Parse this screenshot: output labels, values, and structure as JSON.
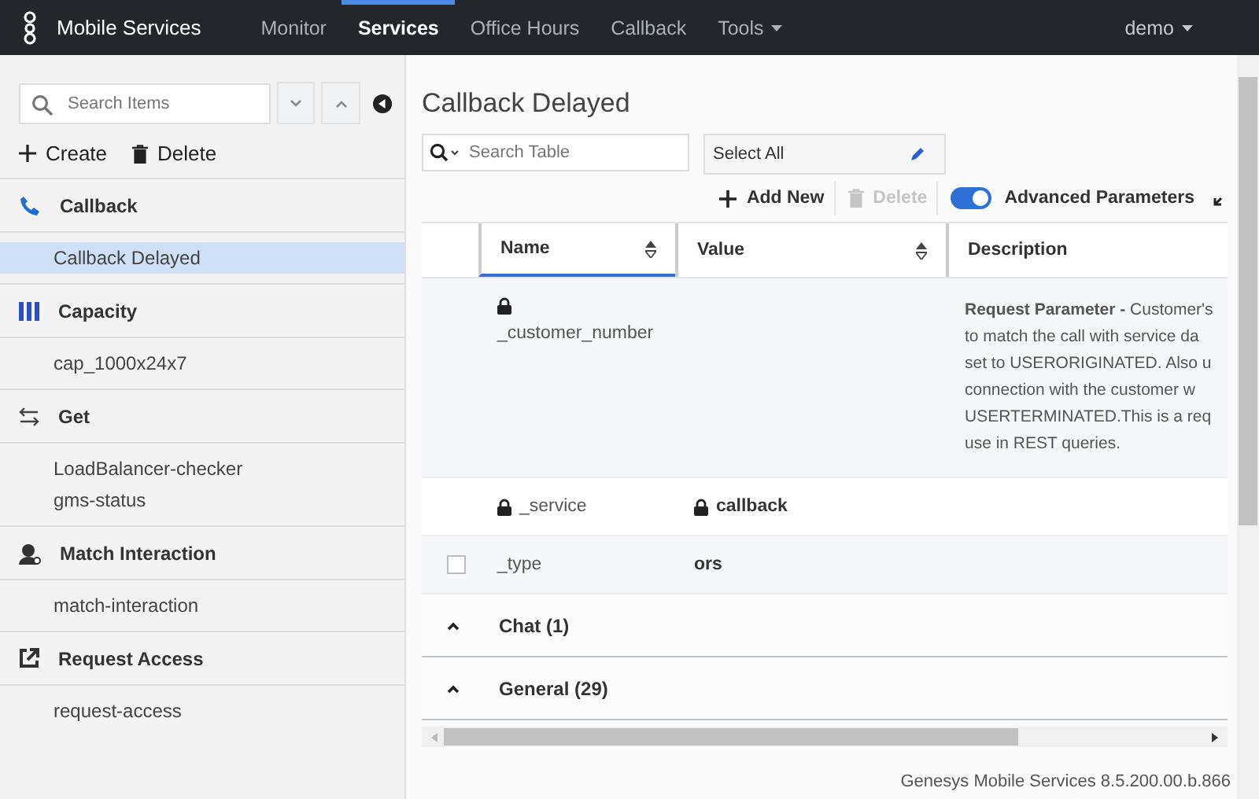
{
  "navbar": {
    "brand": "Mobile Services",
    "tabs": [
      {
        "label": "Monitor",
        "selected": false,
        "dropdown": false
      },
      {
        "label": "Services",
        "selected": true,
        "dropdown": false
      },
      {
        "label": "Office Hours",
        "selected": false,
        "dropdown": false
      },
      {
        "label": "Callback",
        "selected": false,
        "dropdown": false
      },
      {
        "label": "Tools",
        "selected": false,
        "dropdown": true
      }
    ],
    "user": "demo"
  },
  "sidebar": {
    "search": {
      "placeholder": "Search Items"
    },
    "create": "Create",
    "delete": "Delete",
    "groups": [
      {
        "kind": "phone",
        "label": "Callback",
        "items": [
          {
            "label": "Callback Delayed",
            "selected": true
          }
        ]
      },
      {
        "kind": "bars",
        "label": "Capacity",
        "items": [
          {
            "label": "cap_1000x24x7",
            "selected": false
          }
        ]
      },
      {
        "kind": "arrows",
        "label": "Get",
        "items": [
          {
            "label": "LoadBalancer-checker",
            "selected": false
          },
          {
            "label": "gms-status",
            "selected": false
          }
        ]
      },
      {
        "kind": "agent",
        "label": "Match Interaction",
        "items": [
          {
            "label": "match-interaction",
            "selected": false
          }
        ]
      },
      {
        "kind": "external",
        "label": "Request Access",
        "items": [
          {
            "label": "request-access",
            "selected": false
          }
        ]
      }
    ]
  },
  "main": {
    "title": "Callback Delayed",
    "table_search": {
      "placeholder": "Search Table"
    },
    "filter": {
      "value": "Select All"
    },
    "toolbar": {
      "add": "Add New",
      "delete": {
        "label": "Delete",
        "disabled": true
      },
      "advanced": {
        "label": "Advanced Parameters",
        "on": true
      }
    },
    "table": {
      "columns": [
        {
          "label": "Name",
          "sortable": true,
          "selected": true
        },
        {
          "label": "Value",
          "sortable": true,
          "selected": false
        },
        {
          "label": "Description",
          "sortable": false,
          "selected": false
        }
      ],
      "rows": [
        {
          "kind": "locked_wrapped",
          "name": "_customer_number",
          "description": [
            "**Request Parameter -** Customer's",
            "to match the call with service da",
            "set to USERORIGINATED. Also u",
            "connection with the customer w",
            "USERTERMINATED.This is a req",
            "use in REST queries."
          ]
        },
        {
          "kind": "locked",
          "name": "_service",
          "value": "callback",
          "value_locked": true,
          "description": []
        },
        {
          "kind": "editable",
          "checked": false,
          "name": "_type",
          "value": "ors",
          "value_locked": false,
          "description": []
        }
      ],
      "groups": [
        {
          "label": "Chat (1)",
          "expanded": true
        },
        {
          "label": "General (29)",
          "expanded": true
        }
      ]
    },
    "footer": "Genesys Mobile Services 8.5.200.00.b.866"
  }
}
